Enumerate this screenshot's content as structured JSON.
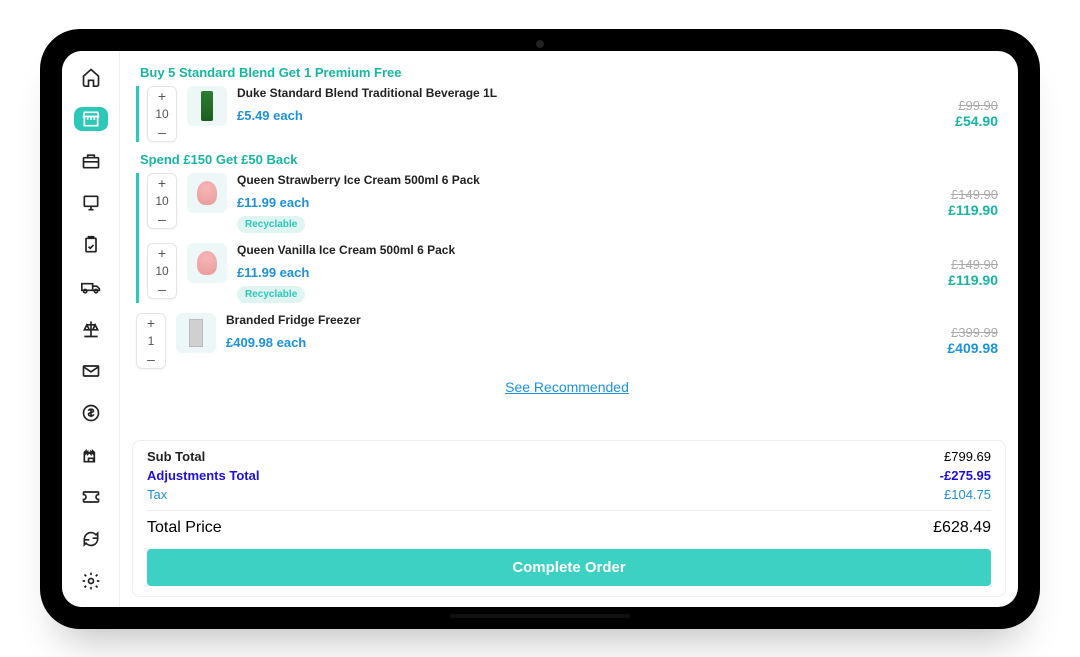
{
  "sidebar": {
    "items": [
      {
        "name": "home"
      },
      {
        "name": "store",
        "active": true
      },
      {
        "name": "briefcase"
      },
      {
        "name": "monitor"
      },
      {
        "name": "clipboard"
      },
      {
        "name": "truck"
      },
      {
        "name": "scale"
      },
      {
        "name": "mail"
      },
      {
        "name": "dollar"
      },
      {
        "name": "castle"
      },
      {
        "name": "ticket"
      },
      {
        "name": "sync"
      },
      {
        "name": "settings"
      }
    ]
  },
  "promos": [
    {
      "title": "Buy 5 Standard Blend Get 1 Premium Free",
      "items": [
        {
          "qty": "10",
          "name": "Duke Standard Blend Traditional Beverage 1L",
          "each": "£5.49 each",
          "old": "£99.90",
          "new": "£54.90",
          "thumb": "bottle"
        }
      ]
    },
    {
      "title": "Spend £150 Get £50 Back",
      "items": [
        {
          "qty": "10",
          "name": "Queen Strawberry Ice Cream 500ml 6 Pack",
          "each": "£11.99 each",
          "old": "£149.90",
          "new": "£119.90",
          "badge": "Recyclable",
          "thumb": "icecream"
        },
        {
          "qty": "10",
          "name": "Queen Vanilla Ice Cream 500ml 6 Pack",
          "each": "£11.99 each",
          "old": "£149.90",
          "new": "£119.90",
          "badge": "Recyclable",
          "thumb": "icecream"
        }
      ]
    }
  ],
  "standalone": [
    {
      "qty": "1",
      "name": "Branded Fridge Freezer",
      "each": "£409.98 each",
      "old": "£399.99",
      "new": "£409.98",
      "thumb": "fridge",
      "new_color": "blue"
    }
  ],
  "see_recommended": "See Recommended",
  "totals": {
    "subtotal_label": "Sub Total",
    "subtotal_value": "£799.69",
    "adjustments_label": "Adjustments Total",
    "adjustments_value": "-£275.95",
    "tax_label": "Tax",
    "tax_value": "£104.75",
    "total_label": "Total Price",
    "total_value": "£628.49",
    "complete_label": "Complete Order"
  }
}
